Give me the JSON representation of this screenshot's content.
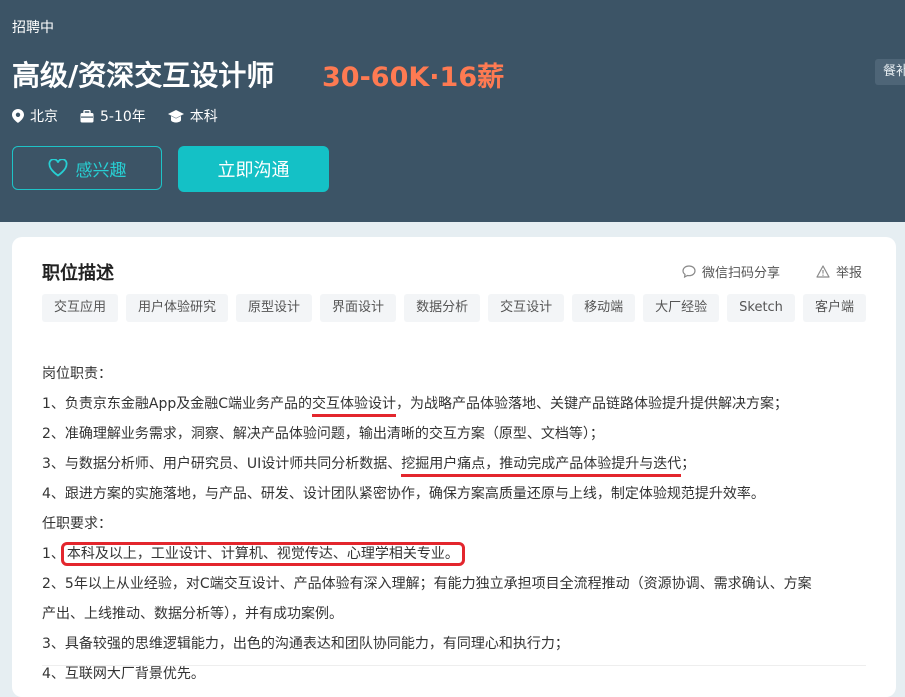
{
  "header": {
    "status": "招聘中",
    "title": "高级/资深交互设计师",
    "salary": "30-60K·16薪",
    "side_tag": "餐补",
    "meta": {
      "location": "北京",
      "experience": "5-10年",
      "education": "本科"
    },
    "interest_label": "感兴趣",
    "chat_label": "立即沟通"
  },
  "card": {
    "title": "职位描述",
    "share_label": "微信扫码分享",
    "report_label": "举报",
    "tags": [
      "交互应用",
      "用户体验研究",
      "原型设计",
      "界面设计",
      "数据分析",
      "交互设计",
      "移动端",
      "大厂经验",
      "Sketch",
      "客户端"
    ],
    "lines": {
      "l0": "岗位职责：",
      "l1a": "1、负责京东金融App及金融C端业务产品的",
      "l1b": "交互体验设计",
      "l1c": "，为战略产品体验落地、关键产品链路体验提升提供解决方案；",
      "l2": "2、准确理解业务需求，洞察、解决产品体验问题，输出清晰的交互方案（原型、文档等）；",
      "l3a": "3、与数据分析师、用户研究员、UI设计师共同分析数据、",
      "l3b": "挖掘用户痛点，推动完成产品体验提升与迭代",
      "l3c": "；",
      "l4": "4、跟进方案的实施落地，与产品、研发、设计团队紧密协作，确保方案高质量还原与上线，制定体验规范提升效率。",
      "l5": "任职要求：",
      "l6a": "1、",
      "l6b": "本科及以上，工业设计、计算机、视觉传达、心理学相关专业。",
      "l7": "2、5年以上从业经验，对C端交互设计、产品体验有深入理解；有能力独立承担项目全流程推动（资源协调、需求确认、方案",
      "l8": "产出、上线推动、数据分析等），并有成功案例。",
      "l9": "3、具备较强的思维逻辑能力，出色的沟通表达和团队协同能力，有同理心和执行力；",
      "l10": "4、互联网大厂背景优先。"
    }
  },
  "colors": {
    "header_bg": "#3c5466",
    "accent": "#14c1c6",
    "salary": "#fe7a52",
    "highlight": "#e3262d"
  },
  "icons": [
    "location-pin-icon",
    "briefcase-icon",
    "graduation-cap-icon",
    "heart-icon",
    "chat-bubble-icon",
    "warning-icon"
  ]
}
